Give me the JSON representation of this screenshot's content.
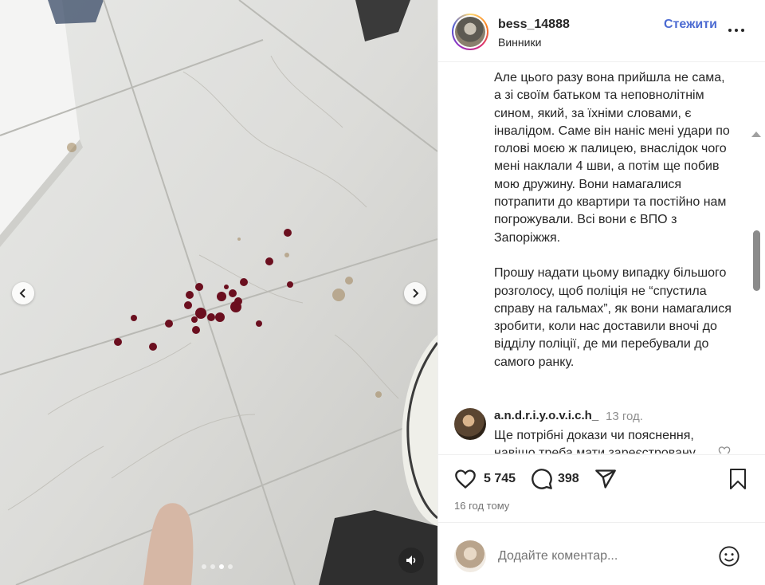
{
  "post": {
    "username": "bess_14888",
    "location": "Винники",
    "follow_label": "Стежити",
    "caption": "Але цього разу вона прийшла не сама, а зі своїм батьком та неповнолітнім сином, який, за їхніми словами, є інвалідом. Саме він наніс мені удари по голові моєю ж палицею, внаслідок чого мені наклали 4 шви, а потім ще побив мою дружину. Вони намагалися потрапити до квартири та постійно нам погрожували. Всі вони є ВПО з Запоріжжя.\n\nПрошу надати цьому випадку більшого розголосу, щоб поліція не “спустила справу на гальмах”, як вони намагалися зробити, коли нас доставили вночі до відділу поліції, де ми перебували до самого ранку."
  },
  "comments": [
    {
      "username": "a.n.d.r.i.y.o.v.i.c.h_",
      "time": "13 год.",
      "text": "Ще потрібні докази чи пояснення, навіщо треба мати зареєстровану"
    }
  ],
  "actions": {
    "likes": "5 745",
    "comments": "398",
    "timestamp": "16 год тому"
  },
  "add_comment": {
    "placeholder": "Додайте коментар..."
  },
  "media": {
    "slide_count": 4,
    "active_slide": 3
  },
  "icons": {
    "prev": "chevron-left-icon",
    "next": "chevron-right-icon",
    "mute": "speaker-icon",
    "like": "heart-icon",
    "comment": "comment-bubble-icon",
    "share": "paper-plane-icon",
    "save": "bookmark-icon",
    "emoji": "smiley-icon",
    "more": "more-horizontal-icon"
  },
  "colors": {
    "follow": "#4c6bd2",
    "text": "#262626",
    "muted": "#8e8e8e"
  }
}
